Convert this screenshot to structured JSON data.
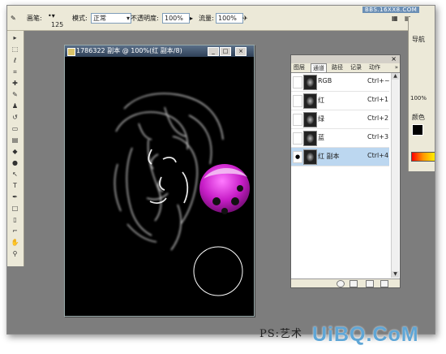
{
  "watermark_top": "BBS.16XX8.COM",
  "options_bar": {
    "brush_label": "画笔:",
    "brush_size": "125",
    "mode_label": "模式:",
    "mode_value": "正常",
    "opacity_label": "不透明度:",
    "opacity_value": "100%",
    "flow_label": "流量:",
    "flow_value": "100%"
  },
  "document": {
    "title": "1786322 副本 @ 100%(红 副本/8)",
    "window_buttons": [
      "_",
      "□",
      "×"
    ]
  },
  "navigator": {
    "tab_label": "导航",
    "zoom": "100%",
    "color_tab_label": "颜色"
  },
  "channels_panel": {
    "close_glyph": "×",
    "tabs": [
      "图层",
      "通道",
      "路径",
      "记录",
      "动作"
    ],
    "active_tab": "通道",
    "more_glyph": "»",
    "rows": [
      {
        "name": "RGB",
        "shortcut": "Ctrl+~",
        "visible": false,
        "selected": false
      },
      {
        "name": "红",
        "shortcut": "Ctrl+1",
        "visible": false,
        "selected": false
      },
      {
        "name": "绿",
        "shortcut": "Ctrl+2",
        "visible": false,
        "selected": false
      },
      {
        "name": "蓝",
        "shortcut": "Ctrl+3",
        "visible": false,
        "selected": false
      },
      {
        "name": "红 副本",
        "shortcut": "Ctrl+4",
        "visible": true,
        "selected": true
      }
    ],
    "eye_glyph": "●"
  },
  "caption": "PS:艺术",
  "logo": "UiBQ.CoM",
  "colors": {
    "app_bg": "#7d7d7d",
    "panel_bg": "#ece9d8",
    "selected_row": "#bcd7f0",
    "ladybug": "#c81ec8",
    "logo": "#5fa6d6"
  }
}
